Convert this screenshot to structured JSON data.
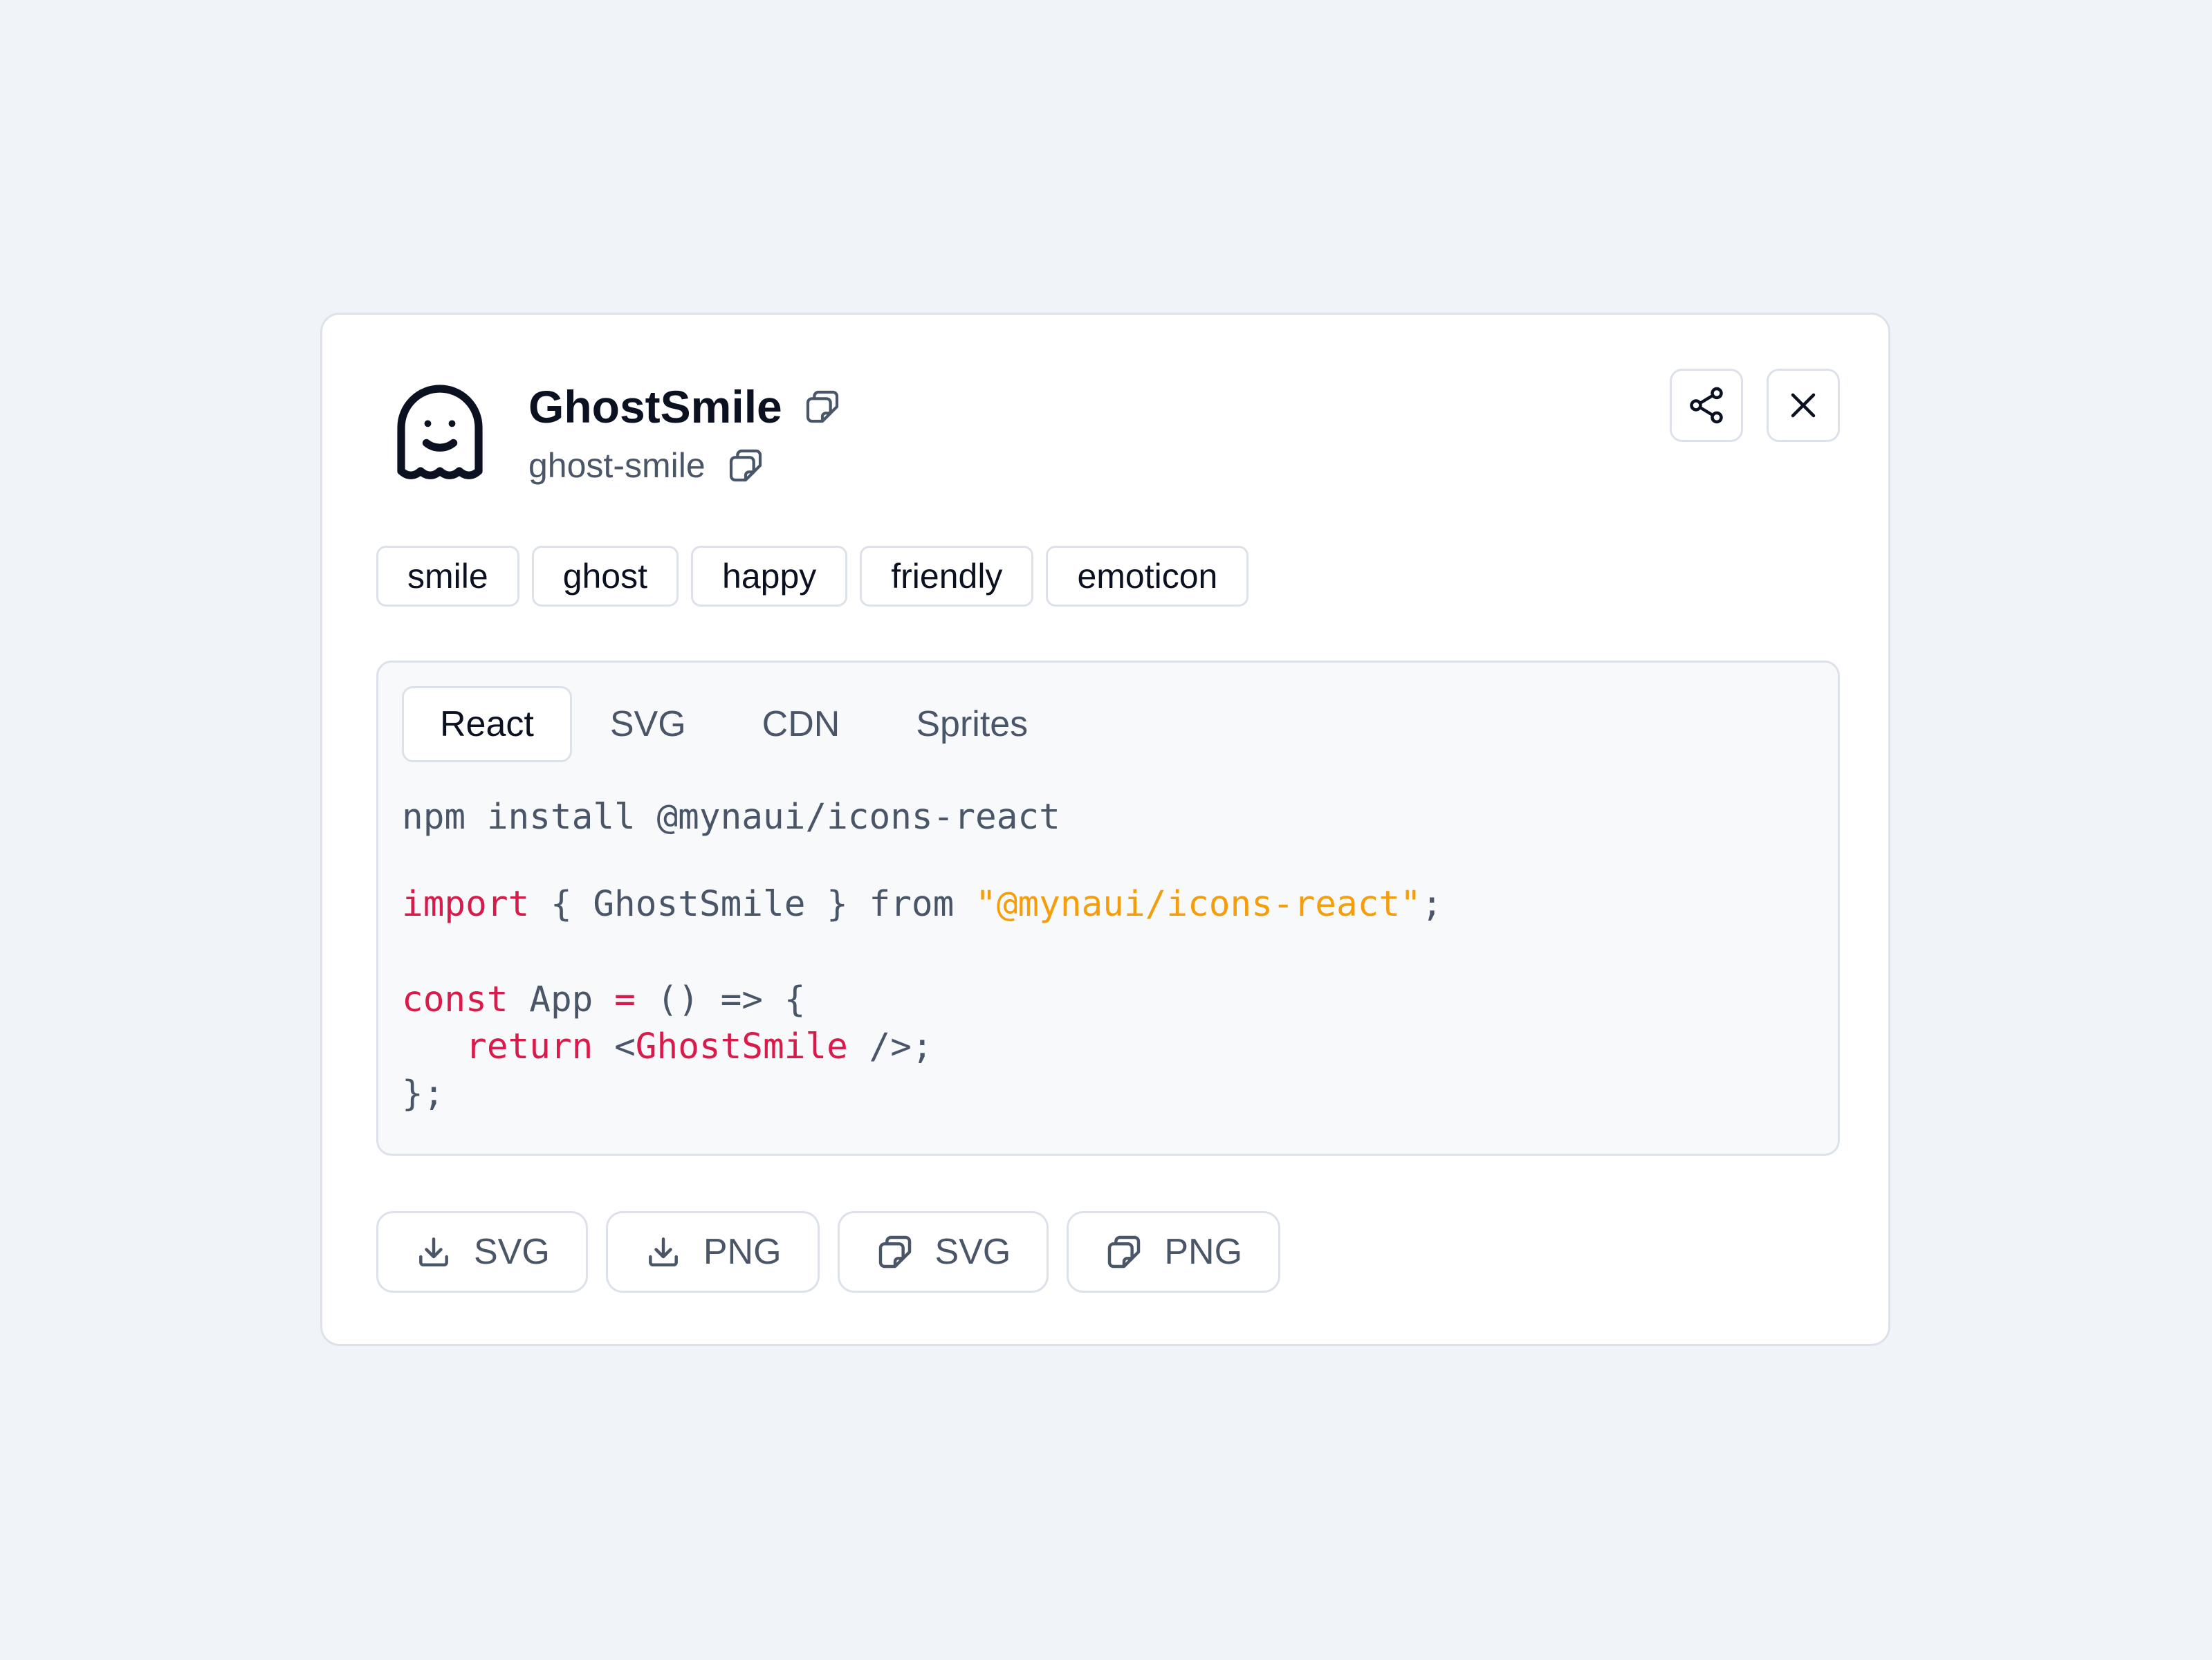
{
  "icon": {
    "name": "GhostSmile",
    "slug": "ghost-smile",
    "preview_icon": "ghost-smile-icon"
  },
  "header_actions": {
    "share_icon": "share-icon",
    "close_icon": "close-icon"
  },
  "tags": [
    "smile",
    "ghost",
    "happy",
    "friendly",
    "emoticon"
  ],
  "tabs": [
    {
      "label": "React",
      "active": true
    },
    {
      "label": "SVG",
      "active": false
    },
    {
      "label": "CDN",
      "active": false
    },
    {
      "label": "Sprites",
      "active": false
    }
  ],
  "code": {
    "install": "npm install @mynaui/icons-react",
    "import_kw": "import",
    "import_names": " { GhostSmile } from ",
    "import_source": "\"@mynaui/icons-react\"",
    "import_end": ";",
    "const_kw": "const",
    "const_eq": " App ",
    "const_op": "=",
    "const_rest": " () => {",
    "return_indent": "   ",
    "return_kw": "return",
    "return_open": " <",
    "return_component": "GhostSmile",
    "return_close": " />;",
    "closing": "};"
  },
  "actions": [
    {
      "icon": "download-icon",
      "label": "SVG"
    },
    {
      "icon": "download-icon",
      "label": "PNG"
    },
    {
      "icon": "copy-icon",
      "label": "SVG"
    },
    {
      "icon": "copy-icon",
      "label": "PNG"
    }
  ],
  "colors": {
    "keyword": "#d81b4a",
    "string": "#f59e0b",
    "background": "#f0f3f8",
    "border": "#dde2ea"
  }
}
